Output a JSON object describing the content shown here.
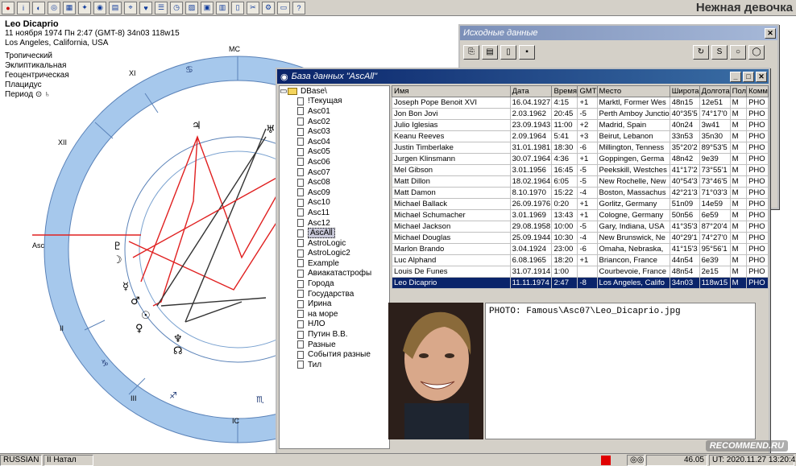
{
  "app": {
    "title": "Нежная девочка"
  },
  "chart": {
    "name": "Leo Dicaprio",
    "date_line": "11 ноября 1974  Пн   2:47 (GMT-8) 34n03  118w15",
    "place": "Los Angeles, California, USA",
    "settings": [
      "Тропический",
      "Эклиптикальная",
      "Геоцентрическая",
      "Плацидус"
    ],
    "period_label": "Период",
    "labels": {
      "mc": "MC",
      "ic": "IC",
      "asc": "Asc",
      "house_xi": "XI",
      "house_xii": "XII",
      "house_ii": "II",
      "house_iii": "III"
    }
  },
  "source_window": {
    "title": "Исходные данные"
  },
  "db_window": {
    "title": "База данных \"AscAll\"",
    "tree_root": "DBase\\",
    "tree_items": [
      "!Текущая",
      "Asc01",
      "Asc02",
      "Asc03",
      "Asc04",
      "Asc05",
      "Asc06",
      "Asc07",
      "Asc08",
      "Asc09",
      "Asc10",
      "Asc11",
      "Asc12",
      "AscAll",
      "AstroLogic",
      "AstroLogic2",
      "Example",
      "Авиакатастрофы",
      "Города",
      "Государства",
      "Ирина",
      "на море",
      "НЛО",
      "Путин В.В.",
      "Разные",
      "События разные",
      "Тил"
    ],
    "tree_selected": "AscAll",
    "columns": [
      "Имя",
      "Дата",
      "Время",
      "GMT",
      "Место",
      "Широта",
      "Долгота",
      "Пол",
      "Комм"
    ],
    "rows": [
      [
        "Joseph Pope Benoit XVI",
        "16.04.1927",
        "4:15",
        "+1",
        "Marktl, Former Wes",
        "48n15",
        "12e51",
        "M",
        "PHO"
      ],
      [
        "Jon Bon Jovi",
        "2.03.1962",
        "20:45",
        "-5",
        "Perth Amboy Junctio",
        "40°35'5",
        "74°17'0",
        "M",
        "PHO"
      ],
      [
        "Julio Iglesias",
        "23.09.1943",
        "11:00",
        "+2",
        "Madrid, Spain",
        "40n24",
        "3w41",
        "M",
        "PHO"
      ],
      [
        "Keanu Reeves",
        "2.09.1964",
        "5:41",
        "+3",
        "Beirut, Lebanon",
        "33n53",
        "35n30",
        "M",
        "PHO"
      ],
      [
        "Justin Timberlake",
        "31.01.1981",
        "18:30",
        "-6",
        "Millington, Tenness",
        "35°20'2",
        "89°53'5",
        "M",
        "PHO"
      ],
      [
        "Jurgen Klinsmann",
        "30.07.1964",
        "4:36",
        "+1",
        "Goppingen, Germa",
        "48n42",
        "9e39",
        "M",
        "PHO"
      ],
      [
        "Mel Gibson",
        "3.01.1956",
        "16:45",
        "-5",
        "Peekskill, Westches",
        "41°17'2",
        "73°55'1",
        "M",
        "PHO"
      ],
      [
        "Matt Dillon",
        "18.02.1964",
        "6:05",
        "-5",
        "New Rochelle, New",
        "40°54'3",
        "73°46'5",
        "M",
        "PHO"
      ],
      [
        "Matt Damon",
        "8.10.1970",
        "15:22",
        "-4",
        "Boston, Massachus",
        "42°21'3",
        "71°03'3",
        "M",
        "PHO"
      ],
      [
        "Michael Ballack",
        "26.09.1976",
        "0:20",
        "+1",
        "Gorlitz, Germany",
        "51n09",
        "14e59",
        "M",
        "PHO"
      ],
      [
        "Michael Schumacher",
        "3.01.1969",
        "13:43",
        "+1",
        "Cologne, Germany",
        "50n56",
        "6e59",
        "M",
        "PHO"
      ],
      [
        "Michael Jackson",
        "29.08.1958",
        "10:00",
        "-5",
        "Gary, Indiana, USA",
        "41°35'3",
        "87°20'4",
        "M",
        "PHO"
      ],
      [
        "Michael Douglas",
        "25.09.1944",
        "10:30",
        "-4",
        "New Brunswick, Ne",
        "40°29'1",
        "74°27'0",
        "M",
        "PHO"
      ],
      [
        "Marlon Brando",
        "3.04.1924",
        "23:00",
        "-6",
        "Omaha, Nebraska,",
        "41°15'3",
        "95°56'1",
        "M",
        "PHO"
      ],
      [
        "Luc Alphand",
        "6.08.1965",
        "18:20",
        "+1",
        "Briancon, France",
        "44n54",
        "6e39",
        "M",
        "PHO"
      ],
      [
        "Louis De Funes",
        "31.07.1914",
        "1:00",
        "",
        "Courbevoie, France",
        "48n54",
        "2e15",
        "M",
        "PHO"
      ],
      [
        "Leo Dicaprio",
        "11.11.1974",
        "2:47",
        "-8",
        "Los Angeles, Califo",
        "34n03",
        "118w15",
        "M",
        "PHO"
      ]
    ],
    "photo_path": "PHOTO: Famous\\Asc07\\Leo_Dicaprio.jpg"
  },
  "statusbar": {
    "language": "RUSSIAN",
    "mode": "II Натал",
    "value": "46.05",
    "ut": "UT: 2020.11.27 13:20:42"
  },
  "watermark": "RECOMMEND.RU",
  "colors": {
    "titlebar": "#0a246a",
    "chart_ring": "#a6c8ec",
    "aspect_red": "#e02020",
    "highlight": "#0a246a"
  }
}
